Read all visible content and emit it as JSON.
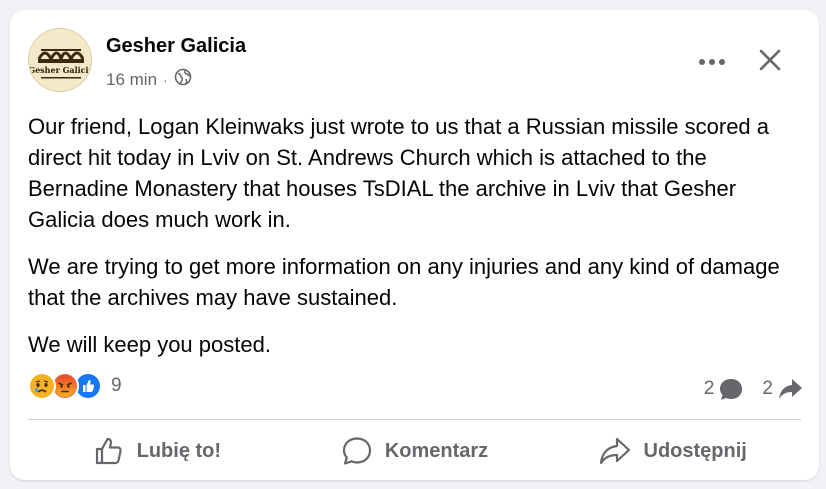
{
  "post": {
    "author": "Gesher Galicia",
    "time": "16 min",
    "separator": "·",
    "logo_text": "Gesher Galicia",
    "paragraphs": [
      "Our friend, Logan Kleinwaks just wrote to us that a Russian missile scored a direct hit today in Lviv on St. Andrews Church which is attached to the Bernadine Monastery that houses TsDIAL the archive in Lviv that Gesher Galicia does much work in.",
      "We are trying to get more information on any injuries and any kind of damage that the archives may have sustained.",
      "We will keep you posted."
    ]
  },
  "reactions": {
    "icons": [
      "sad-reaction-icon",
      "angry-reaction-icon",
      "like-reaction-icon"
    ],
    "count": "9",
    "comments_count": "2",
    "shares_count": "2"
  },
  "actions": {
    "like_label": "Lubię to!",
    "comment_label": "Komentarz",
    "share_label": "Udostępnij"
  },
  "colors": {
    "text": "#050505",
    "secondary": "#65676b",
    "like_blue": "#1877f2",
    "angry": "#f06a3c",
    "sad": "#f7b125"
  }
}
